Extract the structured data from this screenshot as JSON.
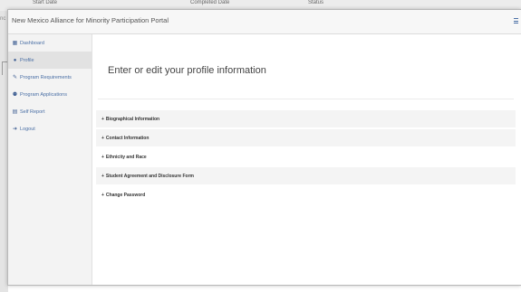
{
  "background": {
    "columns": [
      "Start Date",
      "Completed Date",
      "Status"
    ],
    "left_text": "nc"
  },
  "header": {
    "title": "New Mexico Alliance for Minority Participation Portal",
    "menu_icon": "hamburger-icon"
  },
  "sidebar": {
    "items": [
      {
        "label": "Dashboard",
        "icon": "dashboard-icon",
        "glyph": "▦"
      },
      {
        "label": "Profile",
        "icon": "user-icon",
        "glyph": "●"
      },
      {
        "label": "Program Requirements",
        "icon": "wrench-icon",
        "glyph": "✎"
      },
      {
        "label": "Program Applications",
        "icon": "users-icon",
        "glyph": "⚉"
      },
      {
        "label": "Self Report",
        "icon": "file-icon",
        "glyph": "▤"
      },
      {
        "label": "Logout",
        "icon": "logout-icon",
        "glyph": "➜"
      }
    ]
  },
  "main": {
    "title": "Enter or edit your profile information",
    "sections": [
      "Biographical Information",
      "Contact Information",
      "Ethnicity and Race",
      "Student Agreement and Disclosure Form",
      "Change Password"
    ]
  },
  "colors": {
    "accent": "#4a6fa5"
  }
}
